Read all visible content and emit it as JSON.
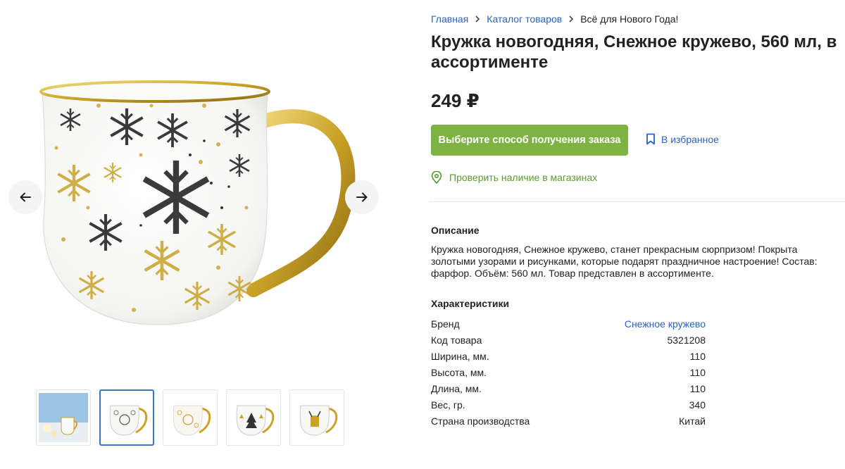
{
  "breadcrumb": [
    {
      "label": "Главная",
      "link": true
    },
    {
      "label": "Каталог товаров",
      "link": true
    },
    {
      "label": "Всё для Нового Года!",
      "link": false
    }
  ],
  "product": {
    "title": "Кружка новогодняя, Снежное кружево, 560 мл, в ассортименте",
    "price": "249 ₽"
  },
  "actions": {
    "order_label": "Выберите способ получения заказа",
    "favorite_label": "В избранное",
    "stock_label": "Проверить наличие в магазинах"
  },
  "description": {
    "heading": "Описание",
    "text": "Кружка новогодняя, Снежное кружево, станет прекрасным сюрпризом! Покрыта золотыми узорами и рисунками, которые подарят праздничное настроение! Состав: фарфор. Объём: 560 мл. Товар представлен в ассортименте."
  },
  "specs": {
    "heading": "Характеристики",
    "rows": [
      {
        "label": "Бренд",
        "value": "Снежное кружево",
        "link": true
      },
      {
        "label": "Код товара",
        "value": "5321208",
        "link": false
      },
      {
        "label": "Ширина, мм.",
        "value": "110",
        "link": false
      },
      {
        "label": "Высота, мм.",
        "value": "110",
        "link": false
      },
      {
        "label": "Длина, мм.",
        "value": "110",
        "link": false
      },
      {
        "label": "Вес, гр.",
        "value": "340",
        "link": false
      },
      {
        "label": "Страна производства",
        "value": "Китай",
        "link": false
      }
    ]
  },
  "gallery": {
    "active_index": 1,
    "thumbnails": [
      "scene",
      "silver-snowflakes",
      "gold-snowflakes",
      "black-trees",
      "gold-deer"
    ]
  },
  "icons": {
    "prev": "arrow-left-icon",
    "next": "arrow-right-icon",
    "breadcrumb_sep": "chevron-right-icon",
    "favorite": "bookmark-icon",
    "stock": "location-pin-icon"
  },
  "colors": {
    "link": "#2a61c5",
    "accent_green": "#7cb342",
    "stock_green": "#5a9a32",
    "gold": "#c9a227"
  }
}
